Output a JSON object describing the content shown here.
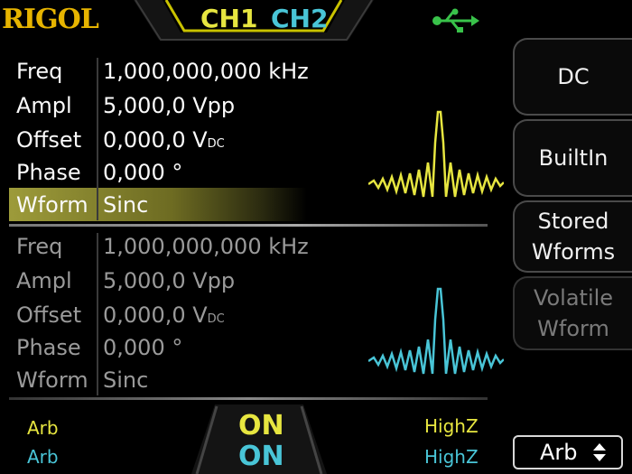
{
  "header": {
    "brand": "RIGOL",
    "ch1_tab": "CH1",
    "ch2_tab": "CH2",
    "usb_icon": "usb-icon"
  },
  "ch1": {
    "rows": [
      {
        "label": "Freq",
        "value": "1,000,000,000 kHz"
      },
      {
        "label": "Ampl",
        "value": "5,000,0 Vpp"
      },
      {
        "label": "Offset",
        "value": "0,000,0 V",
        "unit_sub": "DC"
      },
      {
        "label": "Phase",
        "value": "0,000 °"
      },
      {
        "label": "Wform",
        "value": "Sinc"
      }
    ],
    "color": "#e7e640"
  },
  "ch2": {
    "rows": [
      {
        "label": "Freq",
        "value": "1,000,000,000 kHz"
      },
      {
        "label": "Ampl",
        "value": "5,000,0 Vpp"
      },
      {
        "label": "Offset",
        "value": "0,000,0 V",
        "unit_sub": "DC"
      },
      {
        "label": "Phase",
        "value": "0,000 °"
      },
      {
        "label": "Wform",
        "value": "Sinc"
      }
    ],
    "color": "#49c5d7"
  },
  "softkeys": {
    "dc": "DC",
    "builtin": "BuiltIn",
    "stored_line1": "Stored",
    "stored_line2": "Wforms",
    "volatile_line1": "Volatile",
    "volatile_line2": "Wform"
  },
  "status": {
    "ch1_mode": "Arb",
    "ch2_mode": "Arb",
    "ch1_output": "ON",
    "ch2_output": "ON",
    "ch1_load": "HighZ",
    "ch2_load": "HighZ"
  },
  "selector": {
    "value": "Arb"
  }
}
